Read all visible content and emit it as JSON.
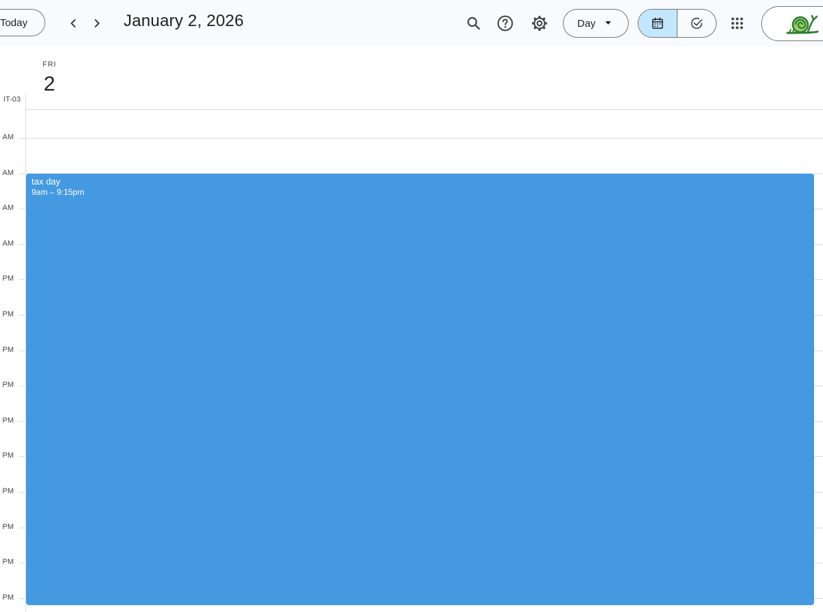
{
  "toolbar": {
    "today_label": "Today",
    "date_title": "January 2, 2026",
    "view_label": "Day"
  },
  "icons": {
    "prev": "chevron-left-icon",
    "next": "chevron-right-icon",
    "search": "search-icon",
    "help": "help-icon",
    "settings": "gear-icon",
    "view_caret": "caret-down-icon",
    "calendar_view": "calendar-icon",
    "tasks_view": "task-check-icon",
    "apps": "apps-grid-icon",
    "account": "snail-logo-icon"
  },
  "day": {
    "dow": "FRI",
    "dom": "2",
    "timezone": "IT-03"
  },
  "hours": [
    "AM",
    "AM",
    "AM",
    "AM",
    "PM",
    "PM",
    "PM",
    "PM",
    "PM",
    "PM",
    "PM",
    "PM",
    "PM",
    "PM"
  ],
  "event": {
    "title": "tax day",
    "time": "9am – 9:15pm",
    "color": "#4499e1"
  },
  "colors": {
    "topbar_bg": "#f8fafd",
    "active_segment": "#c2e7ff",
    "grid": "#dadce0"
  }
}
